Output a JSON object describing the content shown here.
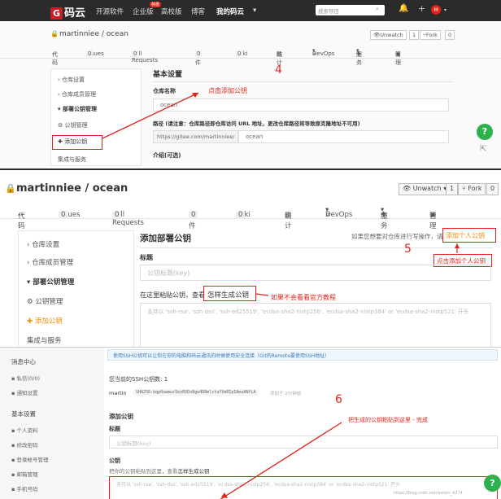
{
  "panel1": {
    "brand": "码云",
    "nav": [
      "开源软件",
      "企业版",
      "高校版",
      "博客",
      "我的码云"
    ],
    "badge": "特惠",
    "search_placeholder": "搜索项目",
    "avatar": "M",
    "repo": "martinniee / ocean",
    "watch": "Unwatch",
    "watch_count": "1",
    "fork": "Fork",
    "fork_count": "0",
    "tabs": [
      "代码",
      "Issues",
      "0",
      "Pull Requests",
      "0",
      "附件",
      "0",
      "Wiki",
      "0",
      "统计",
      "DevOps",
      "服务",
      "管理"
    ],
    "sidebar": [
      "仓库设置",
      "仓库成员管理",
      "部署公钥管理",
      "公钥管理",
      "添加公钥",
      "集成与服务"
    ],
    "section_title": "基本设置",
    "repo_name_label": "仓库名称",
    "repo_name_value": "ocean",
    "path_label": "路径 (请注意：仓库路径即仓库访问 URL 地址，更改仓库路径将导致原克隆地址不可用)",
    "path_prefix": "https://gitee.com/martinniee/",
    "path_value": "ocean",
    "intro_label": "介绍(可选)",
    "step": "4",
    "annotation": "点击添加公钥"
  },
  "panel2": {
    "repo": "martinniee / ocean",
    "watch": "Unwatch",
    "watch_count": "1",
    "fork": "Fork",
    "fork_count": "0",
    "tabs": [
      "代码",
      "Issues",
      "0",
      "Pull Requests",
      "0",
      "附件",
      "0",
      "Wiki",
      "0",
      "统计",
      "DevOps",
      "服务",
      "管理"
    ],
    "sidebar": [
      "仓库设置",
      "仓库成员管理",
      "部署公钥管理",
      "公钥管理",
      "添加公钥",
      "集成与服务"
    ],
    "title": "添加部署公钥",
    "hint": "如果您想要对仓库进行写操作，请",
    "personal_key_link": "添加个人公钥",
    "step": "5",
    "annotation_personal": "点击添加个人公钥",
    "title_label": "标题",
    "title_placeholder": "公钥标题(key)",
    "paste_label": "在这里粘贴公钥，查看",
    "howto_link": "怎样生成公钥",
    "annotation_docs": "如果不会看看官方教程",
    "key_placeholder": "支持以 'ssh-rsa', 'ssh-dss', 'ssh-ed25519', 'ecdsa-sha2-nistp256', 'ecdsa-sha2-nistp384' or 'ecdsa-sha2-nistp521' 开头"
  },
  "panel3": {
    "sidebar_title": "消息中心",
    "sidebar_items_top": [
      "私信(0/0)",
      "通知设置"
    ],
    "sidebar_section": "基本设置",
    "sidebar_items": [
      "个人资料",
      "修改密码",
      "登录帐号管理",
      "邮箱管理",
      "手机号码"
    ],
    "banner": "使用SSH公钥可以让你在你的电脑和码云通讯的时候使用安全连接（Git的Remote要使用SSH地址）",
    "count_label": "您当前的SSH公钥数: 1",
    "key_user": "martin",
    "key_fingerprint": "SHA256:bqp0uwmuc5ezBVDx8gw4DBmlctuYVeRIpIAmuANfLA",
    "key_meta": "添加于 2分钟前",
    "add_title": "添加公钥",
    "title_label": "标题",
    "title_placeholder": "公钥标题(key)",
    "key_label": "公钥",
    "key_hint": "把你的公钥粘贴到这里，查看",
    "howto_link": "怎样生成公钥",
    "key_placeholder": "支持以 'ssh-rsa', 'ssh-dss', 'ssh-ed25519', 'ecdsa-sha2-nistp256', 'ecdsa-sha2-nistp384' or 'ecdsa-sha2-nistp521' 开头",
    "step": "6",
    "annotation": "把生成的公钥粘贴到这里 - 完成",
    "watermark": "https://blog.csdn.net/weixin_4274"
  }
}
